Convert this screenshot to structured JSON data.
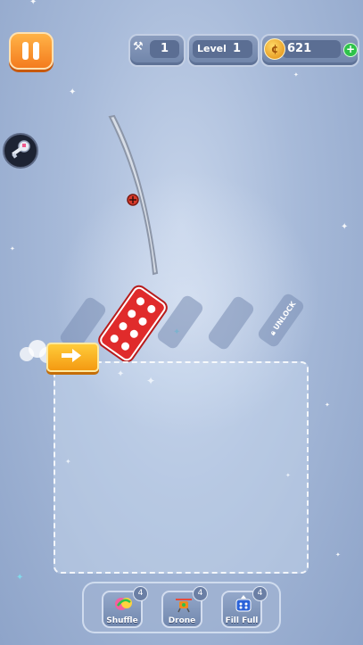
{
  "hud": {
    "moves_value": "1",
    "level_label": "Level",
    "level_value": "1",
    "coins_value": "621"
  },
  "board": {
    "locked_slot_label": "UNLOCK"
  },
  "boosters": [
    {
      "label": "Shuffle",
      "count": "4"
    },
    {
      "label": "Drone",
      "count": "4"
    },
    {
      "label": "Fill Full",
      "count": "4"
    }
  ],
  "colors": {
    "pause": "#f47c1e",
    "domino": "#e02b2b",
    "arrow": "#f7a91a",
    "coin": "#f0a020",
    "plus": "#2ec24a"
  },
  "icons": [
    "pause-icon",
    "moves-icon",
    "coin-icon",
    "plus-icon",
    "key-icon",
    "lock-icon",
    "arrow-right-icon",
    "shuffle-icon",
    "drone-icon",
    "fill-full-icon"
  ]
}
